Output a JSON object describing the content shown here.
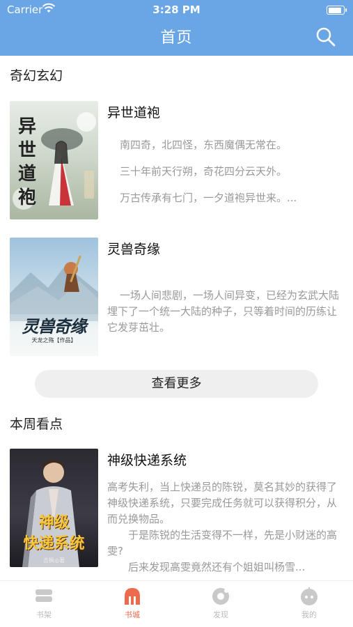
{
  "status_bar": {
    "carrier": "Carrier",
    "time": "3:28 PM"
  },
  "nav": {
    "title": "首页"
  },
  "sections": {
    "fantasy": {
      "title": "奇幻玄幻",
      "books": [
        {
          "title": "异世道袍",
          "cover_text": [
            "异",
            "世",
            "道",
            "袍"
          ],
          "description": [
            "南四奇，北四怪，东西魔偶无常在。",
            "三十年前天行朔，奇花四分云天外。",
            "万古传承有七门，一夕道袍异世来。..."
          ]
        },
        {
          "title": "灵兽奇缘",
          "cover_text": "灵兽奇缘",
          "cover_subtext": "天龙之殇【作品】",
          "description": "一场人间悲剧，一场人间异变，已经为玄武大陆埋下了一个统一大陆的种子，只等着时间的历练让它发芽茁壮。"
        }
      ],
      "more_label": "查看更多"
    },
    "weekly": {
      "title": "本周看点",
      "books": [
        {
          "title": "神级快递系统",
          "cover_text": [
            "神级",
            "快递系统"
          ],
          "cover_subtext": "吉枫◎著",
          "description": [
            "高考失利，当上快递员的陈锐，莫名其妙的获得了神级快递系统，只要完成任务就可以获得积分，从而兑换物品。",
            "于是陈锐的生活变得不一样，先是小财迷的高雯?",
            "后来发现高雯竟然还有个姐姐叫杨雪..."
          ]
        }
      ]
    }
  },
  "tabbar": {
    "tabs": [
      {
        "label": "书架"
      },
      {
        "label": "书城"
      },
      {
        "label": "发现"
      },
      {
        "label": "我的"
      }
    ],
    "active_color": "#ec6b4c",
    "inactive_color": "#bbbbbb"
  },
  "colors": {
    "nav_bg": "#6aa6e6",
    "accent": "#ec6b4c"
  }
}
